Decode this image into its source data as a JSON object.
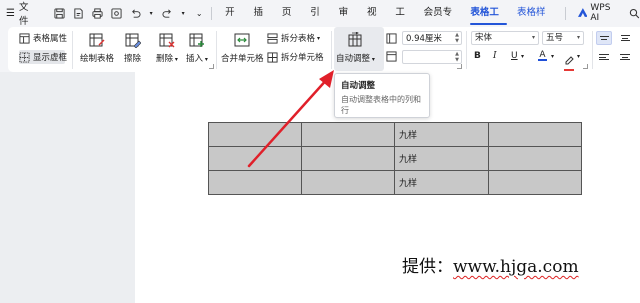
{
  "menubar": {
    "file_label": "文件",
    "tabs": [
      "开始",
      "插入",
      "页面",
      "引用",
      "审阅",
      "视图",
      "工具",
      "会员专享",
      "表格工具",
      "表格样式"
    ],
    "active_tab": "表格工具",
    "wps_ai_label": "WPS AI",
    "icons": [
      "hamburger-icon",
      "save-icon",
      "export-pdf-icon",
      "print-icon",
      "preview-icon",
      "undo-icon",
      "redo-icon",
      "more-chevron-icon",
      "search-icon"
    ]
  },
  "ribbon": {
    "table_properties": "表格属性",
    "show_gridlines": "显示虚框",
    "draw_table": "绘制表格",
    "erase": "擦除",
    "delete": "删除",
    "insert": "插入",
    "merge_cells": "合并单元格",
    "split_table": "拆分表格",
    "split_cells": "拆分单元格",
    "auto_adjust": "自动调整",
    "width_value": "0.94厘米",
    "height_value": "",
    "font_name": "宋体",
    "font_size": "五号",
    "bold": "B",
    "italic": "I",
    "underline": "U",
    "font_color_letter": "A",
    "font_color": "#1f4fd8",
    "highlight_color": "#e53935",
    "accent_color": "#2355d8"
  },
  "tooltip": {
    "title": "自动调整",
    "description": "自动调整表格中的列和行"
  },
  "table": {
    "rows": [
      [
        "",
        "",
        "九样",
        ""
      ],
      [
        "",
        "",
        "九样",
        ""
      ],
      [
        "",
        "",
        "九样",
        ""
      ]
    ]
  },
  "watermark": {
    "prefix": "提供：",
    "url": "www.hjga.com"
  },
  "annotation": {
    "arrow_color": "#e0202a"
  }
}
